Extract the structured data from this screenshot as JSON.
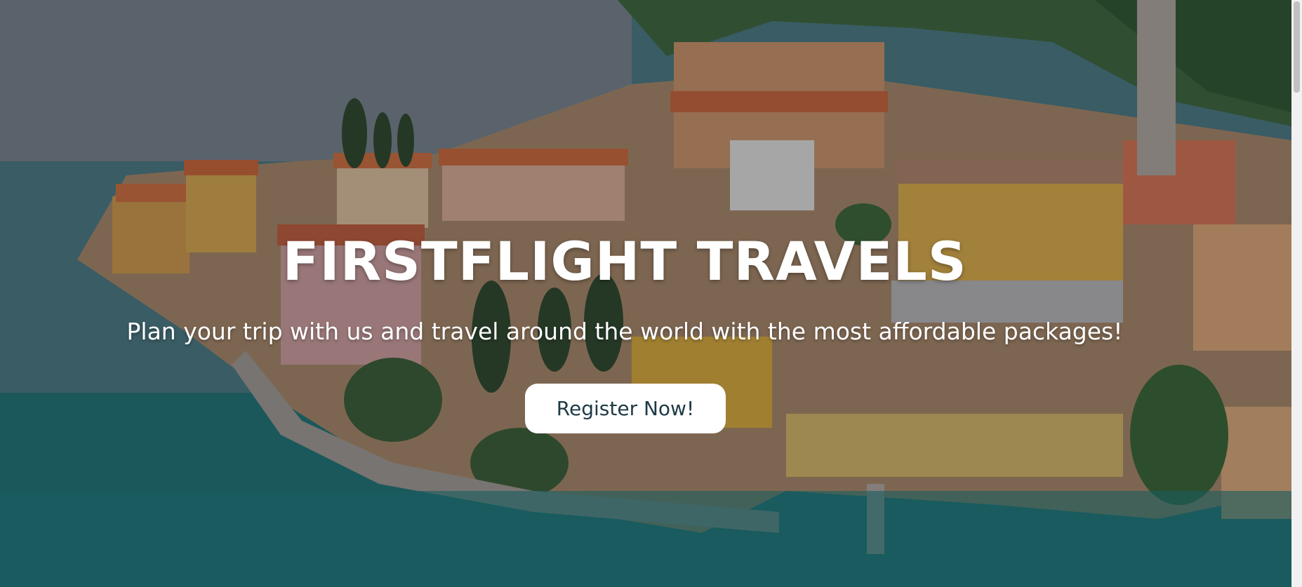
{
  "hero": {
    "title": "FIRSTFLIGHT TRAVELS",
    "subtitle": "Plan your trip with us and travel around the world with the most affordable packages!",
    "cta_label": "Register Now!"
  },
  "colors": {
    "title_text": "#ffffff",
    "button_bg": "#ffffff",
    "button_text": "#1d3a45",
    "water": "#1f6f70",
    "roofs": "#d9743f"
  },
  "icons": {
    "background": "lakeside-town-photo"
  }
}
